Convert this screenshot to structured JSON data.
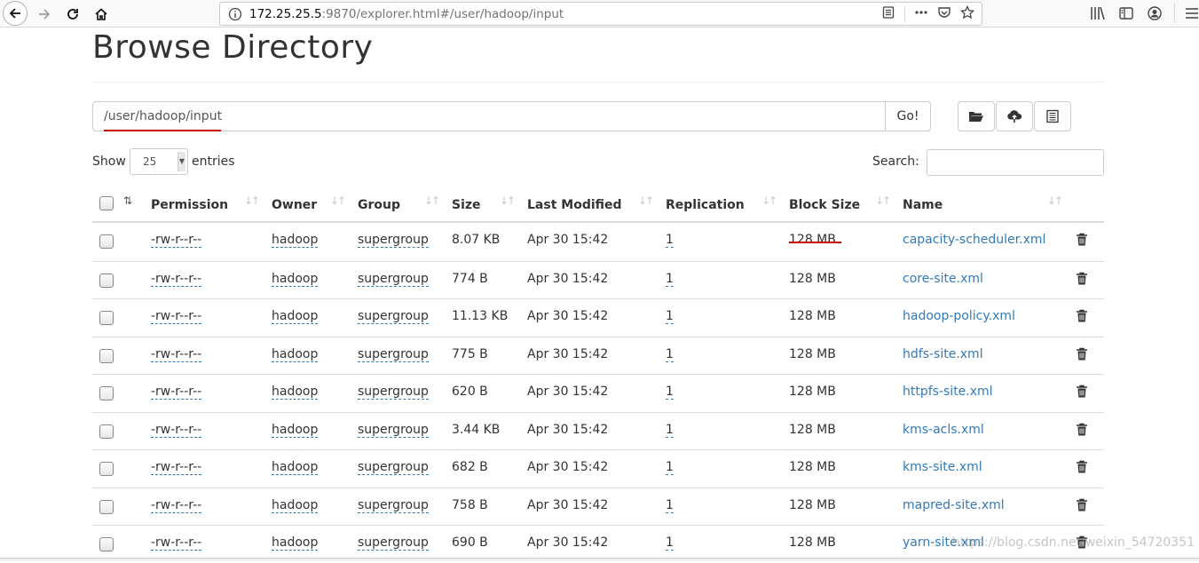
{
  "browser": {
    "url_host": "172.25.25.5",
    "url_rest": ":9870/explorer.html#/user/hadoop/input"
  },
  "page": {
    "title": "Browse Directory",
    "path_value": "/user/hadoop/input",
    "go_label": "Go!",
    "show_label": "Show",
    "entries_value": "25",
    "entries_label": "entries",
    "search_label": "Search:"
  },
  "table": {
    "headers": {
      "permission": "Permission",
      "owner": "Owner",
      "group": "Group",
      "size": "Size",
      "last_modified": "Last Modified",
      "replication": "Replication",
      "block_size": "Block Size",
      "name": "Name"
    },
    "rows": [
      {
        "permission": "-rw-r--r--",
        "owner": "hadoop",
        "group": "supergroup",
        "size": "8.07 KB",
        "modified": "Apr 30 15:42",
        "replication": "1",
        "block_size": "128 MB",
        "name": "capacity-scheduler.xml"
      },
      {
        "permission": "-rw-r--r--",
        "owner": "hadoop",
        "group": "supergroup",
        "size": "774 B",
        "modified": "Apr 30 15:42",
        "replication": "1",
        "block_size": "128 MB",
        "name": "core-site.xml"
      },
      {
        "permission": "-rw-r--r--",
        "owner": "hadoop",
        "group": "supergroup",
        "size": "11.13 KB",
        "modified": "Apr 30 15:42",
        "replication": "1",
        "block_size": "128 MB",
        "name": "hadoop-policy.xml"
      },
      {
        "permission": "-rw-r--r--",
        "owner": "hadoop",
        "group": "supergroup",
        "size": "775 B",
        "modified": "Apr 30 15:42",
        "replication": "1",
        "block_size": "128 MB",
        "name": "hdfs-site.xml"
      },
      {
        "permission": "-rw-r--r--",
        "owner": "hadoop",
        "group": "supergroup",
        "size": "620 B",
        "modified": "Apr 30 15:42",
        "replication": "1",
        "block_size": "128 MB",
        "name": "httpfs-site.xml"
      },
      {
        "permission": "-rw-r--r--",
        "owner": "hadoop",
        "group": "supergroup",
        "size": "3.44 KB",
        "modified": "Apr 30 15:42",
        "replication": "1",
        "block_size": "128 MB",
        "name": "kms-acls.xml"
      },
      {
        "permission": "-rw-r--r--",
        "owner": "hadoop",
        "group": "supergroup",
        "size": "682 B",
        "modified": "Apr 30 15:42",
        "replication": "1",
        "block_size": "128 MB",
        "name": "kms-site.xml"
      },
      {
        "permission": "-rw-r--r--",
        "owner": "hadoop",
        "group": "supergroup",
        "size": "758 B",
        "modified": "Apr 30 15:42",
        "replication": "1",
        "block_size": "128 MB",
        "name": "mapred-site.xml"
      },
      {
        "permission": "-rw-r--r--",
        "owner": "hadoop",
        "group": "supergroup",
        "size": "690 B",
        "modified": "Apr 30 15:42",
        "replication": "1",
        "block_size": "128 MB",
        "name": "yarn-site.xml"
      }
    ]
  },
  "watermark": "https://blog.csdn.net/weixin_54720351",
  "colors": {
    "link": "#337ab7",
    "annotation": "#cc0000"
  }
}
